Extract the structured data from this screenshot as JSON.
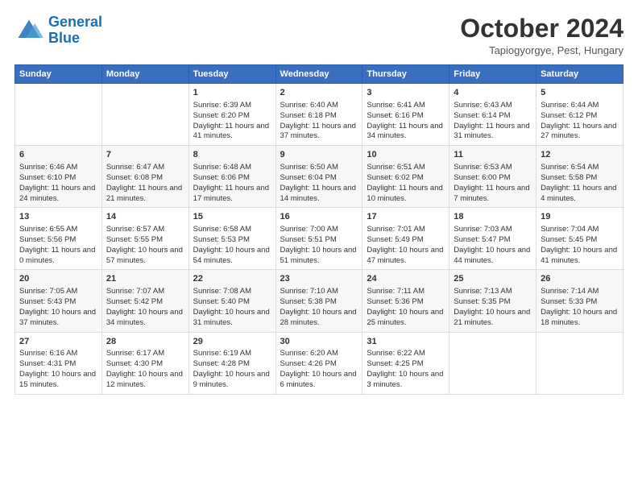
{
  "logo": {
    "line1": "General",
    "line2": "Blue"
  },
  "title": "October 2024",
  "subtitle": "Tapiogyorgye, Pest, Hungary",
  "days_of_week": [
    "Sunday",
    "Monday",
    "Tuesday",
    "Wednesday",
    "Thursday",
    "Friday",
    "Saturday"
  ],
  "weeks": [
    [
      {
        "day": "",
        "info": ""
      },
      {
        "day": "",
        "info": ""
      },
      {
        "day": "1",
        "sunrise": "6:39 AM",
        "sunset": "6:20 PM",
        "daylight": "11 hours and 41 minutes."
      },
      {
        "day": "2",
        "sunrise": "6:40 AM",
        "sunset": "6:18 PM",
        "daylight": "11 hours and 37 minutes."
      },
      {
        "day": "3",
        "sunrise": "6:41 AM",
        "sunset": "6:16 PM",
        "daylight": "11 hours and 34 minutes."
      },
      {
        "day": "4",
        "sunrise": "6:43 AM",
        "sunset": "6:14 PM",
        "daylight": "11 hours and 31 minutes."
      },
      {
        "day": "5",
        "sunrise": "6:44 AM",
        "sunset": "6:12 PM",
        "daylight": "11 hours and 27 minutes."
      }
    ],
    [
      {
        "day": "6",
        "sunrise": "6:46 AM",
        "sunset": "6:10 PM",
        "daylight": "11 hours and 24 minutes."
      },
      {
        "day": "7",
        "sunrise": "6:47 AM",
        "sunset": "6:08 PM",
        "daylight": "11 hours and 21 minutes."
      },
      {
        "day": "8",
        "sunrise": "6:48 AM",
        "sunset": "6:06 PM",
        "daylight": "11 hours and 17 minutes."
      },
      {
        "day": "9",
        "sunrise": "6:50 AM",
        "sunset": "6:04 PM",
        "daylight": "11 hours and 14 minutes."
      },
      {
        "day": "10",
        "sunrise": "6:51 AM",
        "sunset": "6:02 PM",
        "daylight": "11 hours and 10 minutes."
      },
      {
        "day": "11",
        "sunrise": "6:53 AM",
        "sunset": "6:00 PM",
        "daylight": "11 hours and 7 minutes."
      },
      {
        "day": "12",
        "sunrise": "6:54 AM",
        "sunset": "5:58 PM",
        "daylight": "11 hours and 4 minutes."
      }
    ],
    [
      {
        "day": "13",
        "sunrise": "6:55 AM",
        "sunset": "5:56 PM",
        "daylight": "11 hours and 0 minutes."
      },
      {
        "day": "14",
        "sunrise": "6:57 AM",
        "sunset": "5:55 PM",
        "daylight": "10 hours and 57 minutes."
      },
      {
        "day": "15",
        "sunrise": "6:58 AM",
        "sunset": "5:53 PM",
        "daylight": "10 hours and 54 minutes."
      },
      {
        "day": "16",
        "sunrise": "7:00 AM",
        "sunset": "5:51 PM",
        "daylight": "10 hours and 51 minutes."
      },
      {
        "day": "17",
        "sunrise": "7:01 AM",
        "sunset": "5:49 PM",
        "daylight": "10 hours and 47 minutes."
      },
      {
        "day": "18",
        "sunrise": "7:03 AM",
        "sunset": "5:47 PM",
        "daylight": "10 hours and 44 minutes."
      },
      {
        "day": "19",
        "sunrise": "7:04 AM",
        "sunset": "5:45 PM",
        "daylight": "10 hours and 41 minutes."
      }
    ],
    [
      {
        "day": "20",
        "sunrise": "7:05 AM",
        "sunset": "5:43 PM",
        "daylight": "10 hours and 37 minutes."
      },
      {
        "day": "21",
        "sunrise": "7:07 AM",
        "sunset": "5:42 PM",
        "daylight": "10 hours and 34 minutes."
      },
      {
        "day": "22",
        "sunrise": "7:08 AM",
        "sunset": "5:40 PM",
        "daylight": "10 hours and 31 minutes."
      },
      {
        "day": "23",
        "sunrise": "7:10 AM",
        "sunset": "5:38 PM",
        "daylight": "10 hours and 28 minutes."
      },
      {
        "day": "24",
        "sunrise": "7:11 AM",
        "sunset": "5:36 PM",
        "daylight": "10 hours and 25 minutes."
      },
      {
        "day": "25",
        "sunrise": "7:13 AM",
        "sunset": "5:35 PM",
        "daylight": "10 hours and 21 minutes."
      },
      {
        "day": "26",
        "sunrise": "7:14 AM",
        "sunset": "5:33 PM",
        "daylight": "10 hours and 18 minutes."
      }
    ],
    [
      {
        "day": "27",
        "sunrise": "6:16 AM",
        "sunset": "4:31 PM",
        "daylight": "10 hours and 15 minutes."
      },
      {
        "day": "28",
        "sunrise": "6:17 AM",
        "sunset": "4:30 PM",
        "daylight": "10 hours and 12 minutes."
      },
      {
        "day": "29",
        "sunrise": "6:19 AM",
        "sunset": "4:28 PM",
        "daylight": "10 hours and 9 minutes."
      },
      {
        "day": "30",
        "sunrise": "6:20 AM",
        "sunset": "4:26 PM",
        "daylight": "10 hours and 6 minutes."
      },
      {
        "day": "31",
        "sunrise": "6:22 AM",
        "sunset": "4:25 PM",
        "daylight": "10 hours and 3 minutes."
      },
      {
        "day": "",
        "info": ""
      },
      {
        "day": "",
        "info": ""
      }
    ]
  ]
}
